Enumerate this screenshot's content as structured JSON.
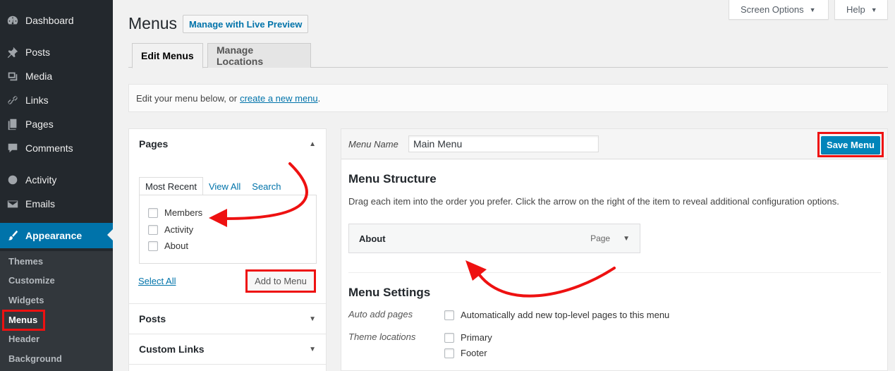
{
  "sidebar": {
    "items": [
      {
        "label": "Dashboard",
        "icon": "dashboard-icon"
      },
      {
        "label": "Posts",
        "icon": "pin-icon"
      },
      {
        "label": "Media",
        "icon": "media-icon"
      },
      {
        "label": "Links",
        "icon": "link-icon"
      },
      {
        "label": "Pages",
        "icon": "pages-icon"
      },
      {
        "label": "Comments",
        "icon": "comment-icon"
      },
      {
        "label": "Activity",
        "icon": "activity-icon"
      },
      {
        "label": "Emails",
        "icon": "email-icon"
      },
      {
        "label": "Appearance",
        "icon": "brush-icon"
      }
    ],
    "submenu": [
      "Themes",
      "Customize",
      "Widgets",
      "Menus",
      "Header",
      "Background"
    ]
  },
  "top": {
    "screen_options": "Screen Options",
    "help": "Help"
  },
  "header": {
    "title": "Menus",
    "live_preview": "Manage with Live Preview"
  },
  "tabs": {
    "edit": "Edit Menus",
    "locations": "Manage Locations"
  },
  "notice": {
    "text": "Edit your menu below, or",
    "link": "create a new menu",
    "end": "."
  },
  "pages_box": {
    "title": "Pages",
    "tabs": [
      "Most Recent",
      "View All",
      "Search"
    ],
    "items": [
      "Members",
      "Activity",
      "About"
    ],
    "select_all": "Select All",
    "add_button": "Add to Menu"
  },
  "accordion": {
    "posts": "Posts",
    "custom_links": "Custom Links"
  },
  "menu": {
    "name_label": "Menu Name",
    "name_value": "Main Menu",
    "save": "Save Menu",
    "structure_title": "Menu Structure",
    "structure_desc": "Drag each item into the order you prefer. Click the arrow on the right of the item to reveal additional configuration options.",
    "item_title": "About",
    "item_type": "Page",
    "settings_title": "Menu Settings",
    "auto_add_label": "Auto add pages",
    "auto_add_text": "Automatically add new top-level pages to this menu",
    "locations_label": "Theme locations",
    "locations": [
      "Primary",
      "Footer"
    ]
  },
  "colors": {
    "accent": "#0073aa",
    "sidebar": "#23282d",
    "annotation": "#ee1111"
  }
}
